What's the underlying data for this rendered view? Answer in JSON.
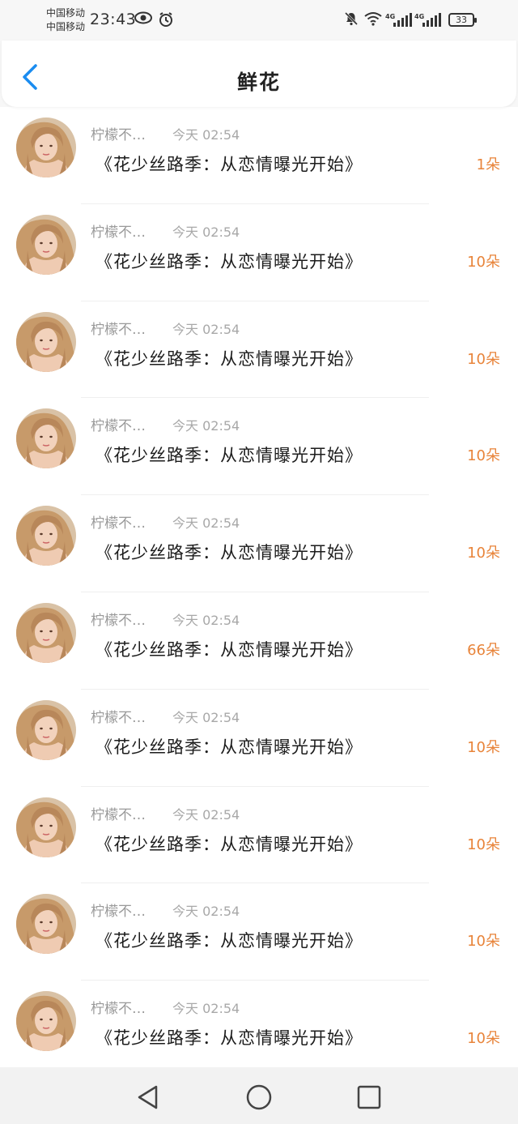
{
  "status_bar": {
    "carrier_1": "中国移动",
    "carrier_2": "中国移动",
    "time": "23:43",
    "network_1": "4G",
    "network_2": "4G",
    "battery": "33"
  },
  "header": {
    "title": "鲜花"
  },
  "list": [
    {
      "user": "柠檬不…",
      "time": "今天 02:54",
      "title": "《花少丝路季：从恋情曝光开始》",
      "amount": "1朵"
    },
    {
      "user": "柠檬不…",
      "time": "今天 02:54",
      "title": "《花少丝路季：从恋情曝光开始》",
      "amount": "10朵"
    },
    {
      "user": "柠檬不…",
      "time": "今天 02:54",
      "title": "《花少丝路季：从恋情曝光开始》",
      "amount": "10朵"
    },
    {
      "user": "柠檬不…",
      "time": "今天 02:54",
      "title": "《花少丝路季：从恋情曝光开始》",
      "amount": "10朵"
    },
    {
      "user": "柠檬不…",
      "time": "今天 02:54",
      "title": "《花少丝路季：从恋情曝光开始》",
      "amount": "10朵"
    },
    {
      "user": "柠檬不…",
      "time": "今天 02:54",
      "title": "《花少丝路季：从恋情曝光开始》",
      "amount": "66朵"
    },
    {
      "user": "柠檬不…",
      "time": "今天 02:54",
      "title": "《花少丝路季：从恋情曝光开始》",
      "amount": "10朵"
    },
    {
      "user": "柠檬不…",
      "time": "今天 02:54",
      "title": "《花少丝路季：从恋情曝光开始》",
      "amount": "10朵"
    },
    {
      "user": "柠檬不…",
      "time": "今天 02:54",
      "title": "《花少丝路季：从恋情曝光开始》",
      "amount": "10朵"
    },
    {
      "user": "柠檬不…",
      "time": "今天 02:54",
      "title": "《花少丝路季：从恋情曝光开始》",
      "amount": "10朵"
    }
  ],
  "colors": {
    "accent_blue": "#1a8cf0",
    "amount_orange": "#e8843a",
    "muted_text": "#9a9a9a"
  },
  "icons": {
    "back": "chevron-left-icon",
    "nav_back": "triangle-back-icon",
    "nav_home": "circle-home-icon",
    "nav_recent": "square-recent-icon"
  }
}
